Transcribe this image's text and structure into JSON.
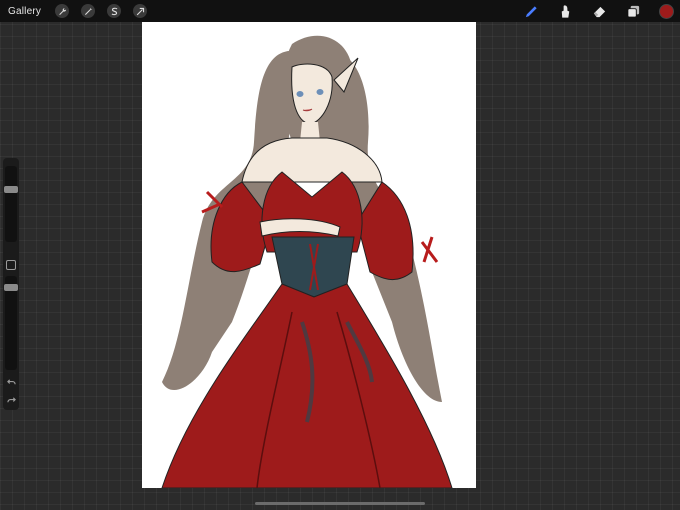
{
  "topbar": {
    "gallery_label": "Gallery",
    "left_tools": [
      "wrench-icon",
      "magic-wand-icon",
      "selection-icon",
      "transform-arrow-icon"
    ],
    "right_tools": [
      "brush-icon",
      "smudge-icon",
      "eraser-icon",
      "layers-icon"
    ],
    "active_tool": "brush-icon",
    "current_color": "#9e1b1b"
  },
  "sidebar": {
    "brush_size_level": 0.12,
    "opacity_level": 0.05
  },
  "colors": {
    "ui_bg": "#2b2b2b",
    "topbar": "#111111",
    "accent_active": "#4a7dff",
    "dress_red": "#9e1b1b",
    "hair": "#8e8076",
    "corset": "#2f4650",
    "skin": "#f3e9dd"
  }
}
